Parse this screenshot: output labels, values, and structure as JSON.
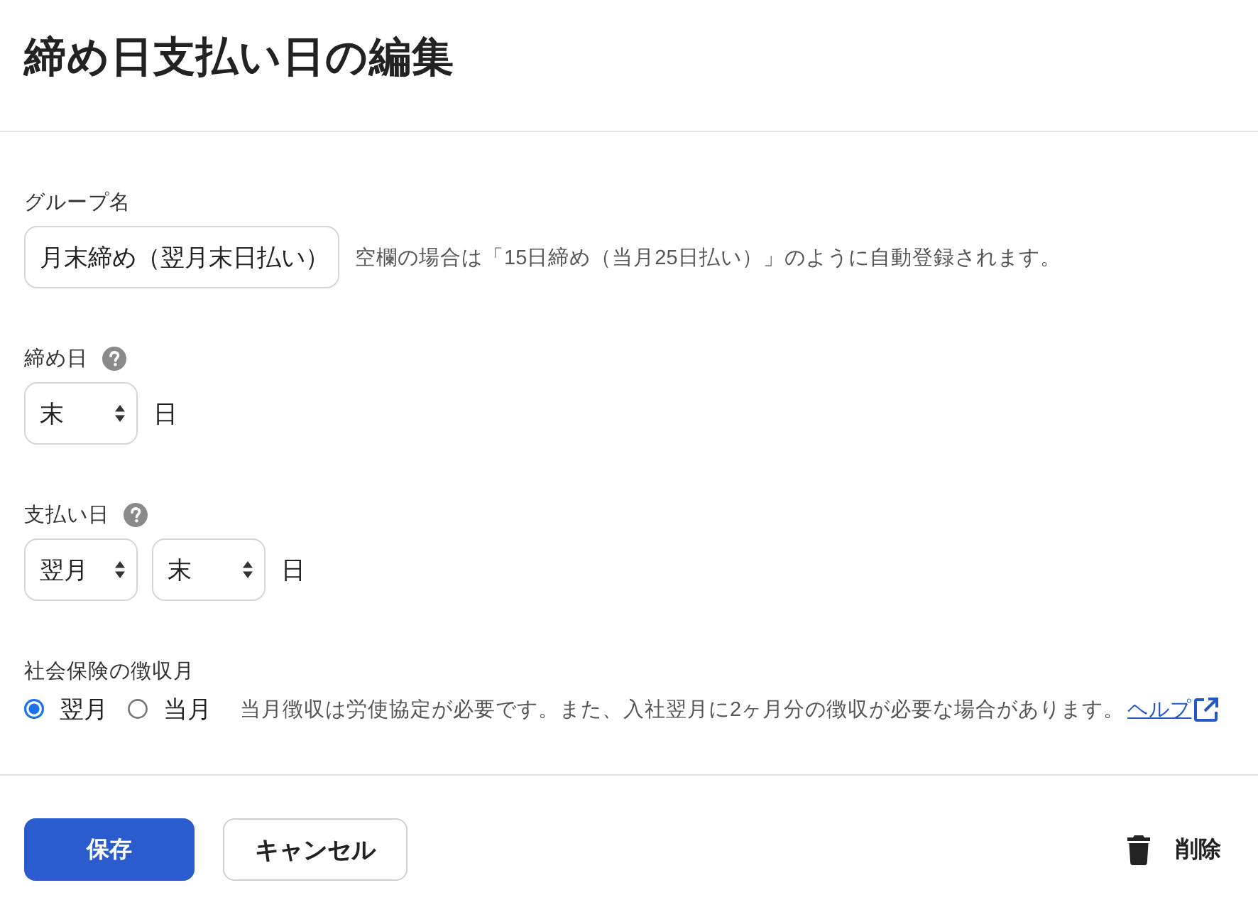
{
  "dialog": {
    "title": "締め日支払い日の編集"
  },
  "group_name": {
    "label": "グループ名",
    "help": false,
    "value": "月末締め（翌月末日払い）",
    "hint": "空欄の場合は「15日締め（当月25日払い）」のように自動登録されます。"
  },
  "closing_day": {
    "label": "締め日",
    "help": true,
    "selects": [
      {
        "value": "末"
      }
    ],
    "unit": "日"
  },
  "payment_day": {
    "label": "支払い日",
    "help": true,
    "selects": [
      {
        "value": "翌月"
      },
      {
        "value": "末"
      }
    ],
    "unit": "日"
  },
  "social_insurance": {
    "label": "社会保険の徴収月",
    "help": false,
    "options": [
      {
        "label": "翌月",
        "selected": true
      },
      {
        "label": "当月",
        "selected": false
      }
    ],
    "note": "当月徴収は労使協定が必要です。また、入社翌月に2ヶ月分の徴収が必要な場合があります。",
    "link": "ヘルプ"
  },
  "buttons": [
    {
      "label": "保存",
      "kind": "primary"
    },
    {
      "label": "キャンセル",
      "kind": "secondary"
    },
    {
      "label": "削除",
      "kind": "delete"
    }
  ]
}
